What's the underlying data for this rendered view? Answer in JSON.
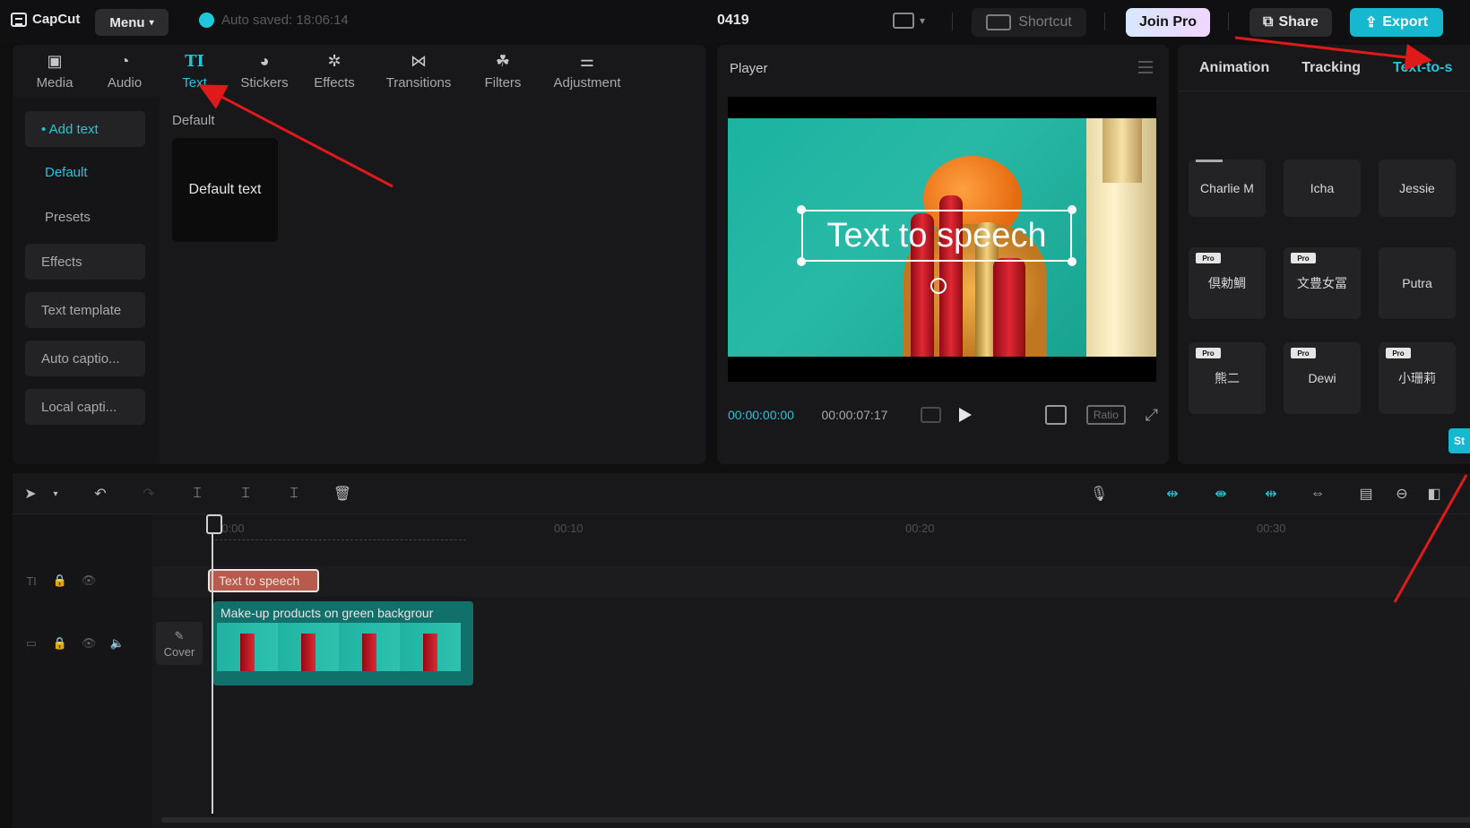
{
  "app": {
    "logo_text": "CapCut",
    "menu_label": "Menu",
    "autosave_text": "Auto saved: 18:06:14",
    "project_name": "0419",
    "shortcut_label": "Shortcut",
    "join_pro_label": "Join Pro",
    "share_label": "Share",
    "export_label": "Export"
  },
  "toolbar": {
    "items": [
      {
        "label": "Media",
        "icon": "media-icon"
      },
      {
        "label": "Audio",
        "icon": "audio-icon"
      },
      {
        "label": "Text",
        "icon": "text-icon",
        "active": true
      },
      {
        "label": "Stickers",
        "icon": "stickers-icon"
      },
      {
        "label": "Effects",
        "icon": "effects-icon"
      },
      {
        "label": "Transitions",
        "icon": "transitions-icon"
      },
      {
        "label": "Filters",
        "icon": "filters-icon"
      },
      {
        "label": "Adjustment",
        "icon": "adjustment-icon"
      }
    ]
  },
  "text_sidebar": {
    "items": [
      {
        "label": "• Add text"
      },
      {
        "label": "Default"
      },
      {
        "label": "Presets"
      },
      {
        "label": "Effects"
      },
      {
        "label": "Text template"
      },
      {
        "label": "Auto captio..."
      },
      {
        "label": "Local capti..."
      }
    ]
  },
  "text_content": {
    "section_label": "Default",
    "card_label": "Default text"
  },
  "player": {
    "title": "Player",
    "overlay_text": "Text to speech",
    "current_time": "00:00:00:00",
    "total_time": "00:00:07:17",
    "ratio_label": "Ratio"
  },
  "right_panel": {
    "tabs": [
      {
        "label": "Animation"
      },
      {
        "label": "Tracking"
      },
      {
        "label": "Text-to-s",
        "active": true
      }
    ],
    "voices": [
      {
        "label": "Charlie M",
        "pro": false
      },
      {
        "label": "Icha",
        "pro": false
      },
      {
        "label": "Jessie",
        "pro": false
      },
      {
        "label": "倶勅鯛",
        "pro": true
      },
      {
        "label": "文豊女冨",
        "pro": true
      },
      {
        "label": "Putra",
        "pro": false
      },
      {
        "label": "熊二",
        "pro": true
      },
      {
        "label": "Dewi",
        "pro": true
      },
      {
        "label": "小珊莉",
        "pro": true
      }
    ],
    "pro_badge": "Pro",
    "start_label": "St"
  },
  "timeline": {
    "ruler": [
      "00:00",
      "00:10",
      "00:20",
      "00:30"
    ],
    "text_clip_label": "Text to speech",
    "video_clip_label": "Make-up products on green backgrour",
    "cover_label": "Cover"
  },
  "colors": {
    "accent": "#1fc7da",
    "export_bg": "#16b8cf",
    "annotation_arrow": "#e01a1a"
  }
}
